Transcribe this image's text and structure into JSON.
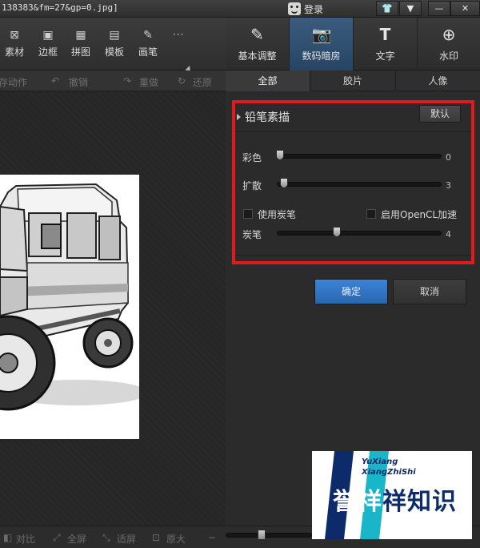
{
  "window": {
    "title": "138383&fm=27&gp=0.jpg]",
    "login_label": "登录",
    "buttons": [
      "shirt-icon",
      "menu-icon",
      "minimize-icon",
      "maximize-icon",
      "close-icon"
    ]
  },
  "toolbar": {
    "tools": [
      {
        "label": "素材",
        "icon": "star-icon"
      },
      {
        "label": "边框",
        "icon": "frame-icon"
      },
      {
        "label": "拼图",
        "icon": "grid-icon"
      },
      {
        "label": "模板",
        "icon": "template-icon"
      },
      {
        "label": "画笔",
        "icon": "brush-icon"
      }
    ],
    "more": "···"
  },
  "modes": [
    {
      "label": "基本调整",
      "icon": "edit-icon",
      "active": false
    },
    {
      "label": "数码暗房",
      "icon": "camera-icon",
      "active": true
    },
    {
      "label": "文字",
      "icon": "text-icon",
      "active": false
    },
    {
      "label": "水印",
      "icon": "watermark-icon",
      "active": false
    }
  ],
  "actions": {
    "save_action": "保存动作",
    "undo": "撤销",
    "redo": "重做",
    "restore": "还原"
  },
  "tabs": [
    "全部",
    "胶片",
    "人像"
  ],
  "effect": {
    "title": "铅笔素描",
    "default_button": "默认",
    "params": [
      {
        "label": "彩色",
        "value": "0",
        "fraction": 0.0
      },
      {
        "label": "扩散",
        "value": "3",
        "fraction": 0.03
      },
      {
        "label": "炭笔",
        "value": "4",
        "fraction": 0.37
      }
    ],
    "use_charcoal": "使用炭笔",
    "enable_opencl": "启用OpenCL加速"
  },
  "dialog": {
    "ok": "确定",
    "cancel": "取消"
  },
  "statusbar": {
    "compare": "对比",
    "fullscreen": "全屏",
    "fit": "适屏",
    "original": "原大",
    "zoom_level": 0.38
  },
  "watermark_logo": {
    "en_line1": "YuXiang",
    "en_line2": "XiangZhiShi",
    "cn_part1": "誉祥",
    "cn_part2": "祥知识"
  },
  "colors": {
    "accent": "#2f72c4",
    "highlight_box": "#e01b1b"
  }
}
